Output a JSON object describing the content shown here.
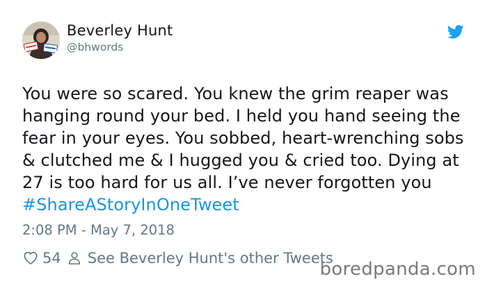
{
  "author": {
    "name": "Beverley Hunt",
    "handle": "@bhwords"
  },
  "tweet": {
    "text": "You were so scared. You knew the grim reaper was hanging round your bed. I held you hand seeing the fear in your eyes. You sobbed, heart-wrenching sobs & clutched me & I hugged you & cried too. Dying at 27 is too hard for us all. I’ve never forgotten you ",
    "hashtag": "#ShareAStoryInOneTweet",
    "timestamp": "2:08 PM - May 7, 2018"
  },
  "actions": {
    "likes": "54",
    "other_tweets_label": "See Beverley Hunt's other Tweets"
  },
  "icons": {
    "bird": "twitter-bird-icon",
    "heart": "heart-icon",
    "person": "person-icon"
  },
  "colors": {
    "link_blue": "#1b95e0",
    "muted_gray": "#657786",
    "text_dark": "#14171a",
    "bird_blue": "#1da1f2"
  },
  "watermark": "boredpanda.com"
}
